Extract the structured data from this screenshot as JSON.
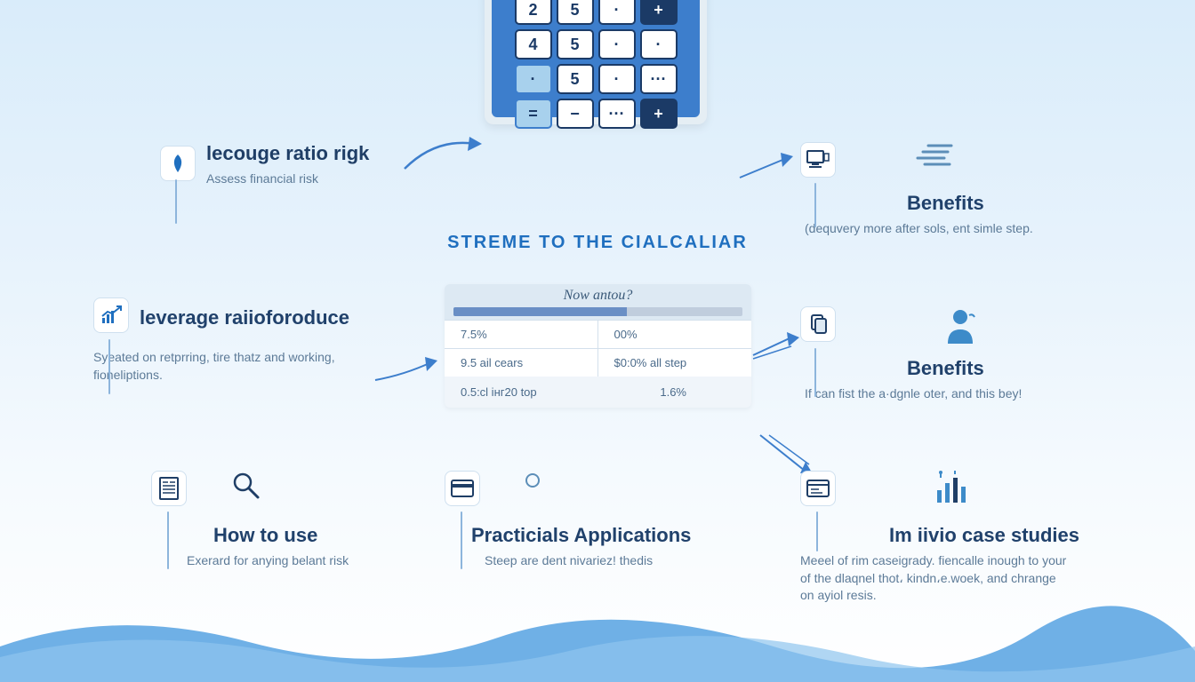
{
  "calculator": {
    "rows": [
      [
        "2",
        "5",
        "·",
        "+"
      ],
      [
        "4",
        "5",
        "·",
        "·"
      ],
      [
        "·",
        "5",
        "·",
        "···"
      ],
      [
        "=",
        "−",
        "···",
        "+"
      ]
    ]
  },
  "blocks": {
    "risk": {
      "title": "lecouge ratio rigk",
      "subtitle": "Assess financial risk"
    },
    "benefits1": {
      "title": "Benefits",
      "subtitle": "(dequvery more after sols, ent simle step."
    },
    "tagline": "STREME TO THE CIALCALIAR",
    "leverage": {
      "title": "leverage raiioforoduce",
      "subtitle": "Syeated on retprring, tire thatz and working, fioneliptions."
    },
    "table": {
      "header": "Now antou?",
      "rows": [
        [
          "7.5%",
          "00%"
        ],
        [
          "9.5 ail cears",
          "$0:0% all step"
        ]
      ],
      "lastLeft": "0.5:cl інг20 top",
      "lastRight": "1.6%"
    },
    "benefits2": {
      "title": "Benefits",
      "subtitle": "If can fist the a·dgnle oter, and this bey!"
    },
    "howto": {
      "title": "How to use",
      "subtitle": "Exerard for anying belant risk"
    },
    "practical": {
      "title": "Practicials Applications",
      "subtitle": "Steep are dent nivariez! thedis"
    },
    "case": {
      "title": "Im iivio case studies",
      "subtitle": "Meeel of rim caseigrady. fiencalle inough to your of the dlaqnel thot، kindn،e.woek, and chrange on ayiol resis."
    }
  },
  "colors": {
    "deepBlue": "#1b3a66",
    "midBlue": "#3d7ecc",
    "lightBlue": "#a8d1ed",
    "waveBlue": "#6fb0e6"
  }
}
